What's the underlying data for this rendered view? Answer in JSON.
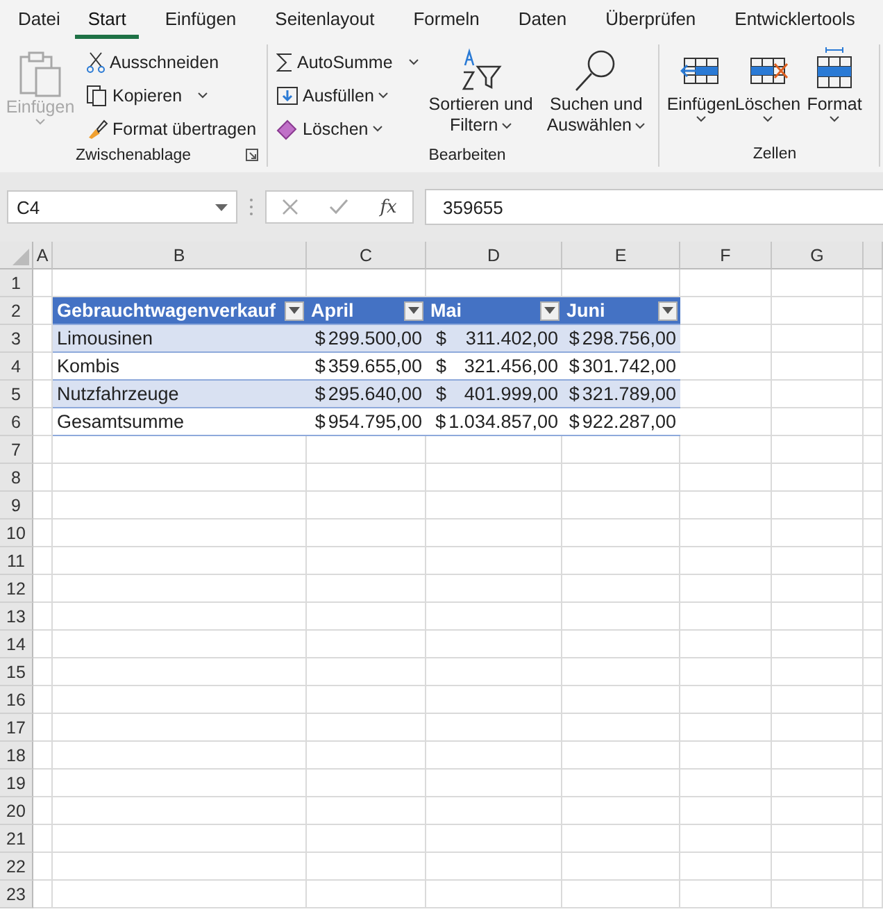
{
  "tabs": [
    {
      "label": "Datei",
      "selected": false
    },
    {
      "label": "Start",
      "selected": true
    },
    {
      "label": "Einfügen",
      "selected": false
    },
    {
      "label": "Seitenlayout",
      "selected": false
    },
    {
      "label": "Formeln",
      "selected": false
    },
    {
      "label": "Daten",
      "selected": false
    },
    {
      "label": "Überprüfen",
      "selected": false
    },
    {
      "label": "Entwicklertools",
      "selected": false
    }
  ],
  "ribbon": {
    "clipboard": {
      "title": "Zwischenablage",
      "paste": {
        "label": "Einfügen",
        "disabled": true
      },
      "cut": "Ausschneiden",
      "copy": "Kopieren",
      "format_painter": "Format übertragen"
    },
    "editing": {
      "title": "Bearbeiten",
      "autosum": "AutoSumme",
      "fill": "Ausfüllen",
      "clear": "Löschen",
      "sort_line1": "Sortieren und",
      "sort_line2": "Filtern",
      "find_line1": "Suchen und",
      "find_line2": "Auswählen"
    },
    "cells": {
      "title": "Zellen",
      "items": [
        {
          "kind": "insert",
          "label": "Einfügen"
        },
        {
          "kind": "delete",
          "label": "Löschen"
        },
        {
          "kind": "format",
          "label": "Format"
        }
      ]
    }
  },
  "formula_bar": {
    "name_box": "C4",
    "function_button": "fx",
    "value": "359655"
  },
  "sheet": {
    "columns": [
      "A",
      "B",
      "C",
      "D",
      "E",
      "F",
      "G"
    ],
    "rows": [
      "1",
      "2",
      "3",
      "4",
      "5",
      "6",
      "7",
      "8",
      "9",
      "10",
      "11",
      "12",
      "13",
      "14",
      "15",
      "16",
      "17",
      "18",
      "19",
      "20",
      "21",
      "22",
      "23"
    ],
    "table": {
      "header": [
        "Gebrauchtwagenverkauf",
        "April",
        "Mai",
        "Juni"
      ],
      "rows": [
        {
          "label": "Limousinen",
          "values": [
            {
              "kind": "currency",
              "symbol": "$",
              "amount": "299.500,00"
            },
            {
              "kind": "accounting",
              "symbol": "$",
              "amount": "311.402,00"
            },
            {
              "kind": "currency",
              "symbol": "$",
              "amount": "298.756,00"
            }
          ]
        },
        {
          "label": "Kombis",
          "values": [
            {
              "kind": "currency",
              "symbol": "$",
              "amount": "359.655,00"
            },
            {
              "kind": "accounting",
              "symbol": "$",
              "amount": "321.456,00"
            },
            {
              "kind": "currency",
              "symbol": "$",
              "amount": "301.742,00"
            }
          ]
        },
        {
          "label": "Nutzfahrzeuge",
          "values": [
            {
              "kind": "currency",
              "symbol": "$",
              "amount": "295.640,00"
            },
            {
              "kind": "accounting",
              "symbol": "$",
              "amount": "401.999,00"
            },
            {
              "kind": "currency",
              "symbol": "$",
              "amount": "321.789,00"
            }
          ]
        },
        {
          "label": "Gesamtsumme",
          "values": [
            {
              "kind": "currency",
              "symbol": "$",
              "amount": "954.795,00"
            },
            {
              "kind": "currency",
              "symbol": "$",
              "amount": "1.034.857,00"
            },
            {
              "kind": "currency",
              "symbol": "$",
              "amount": "922.287,00"
            }
          ]
        }
      ]
    }
  }
}
